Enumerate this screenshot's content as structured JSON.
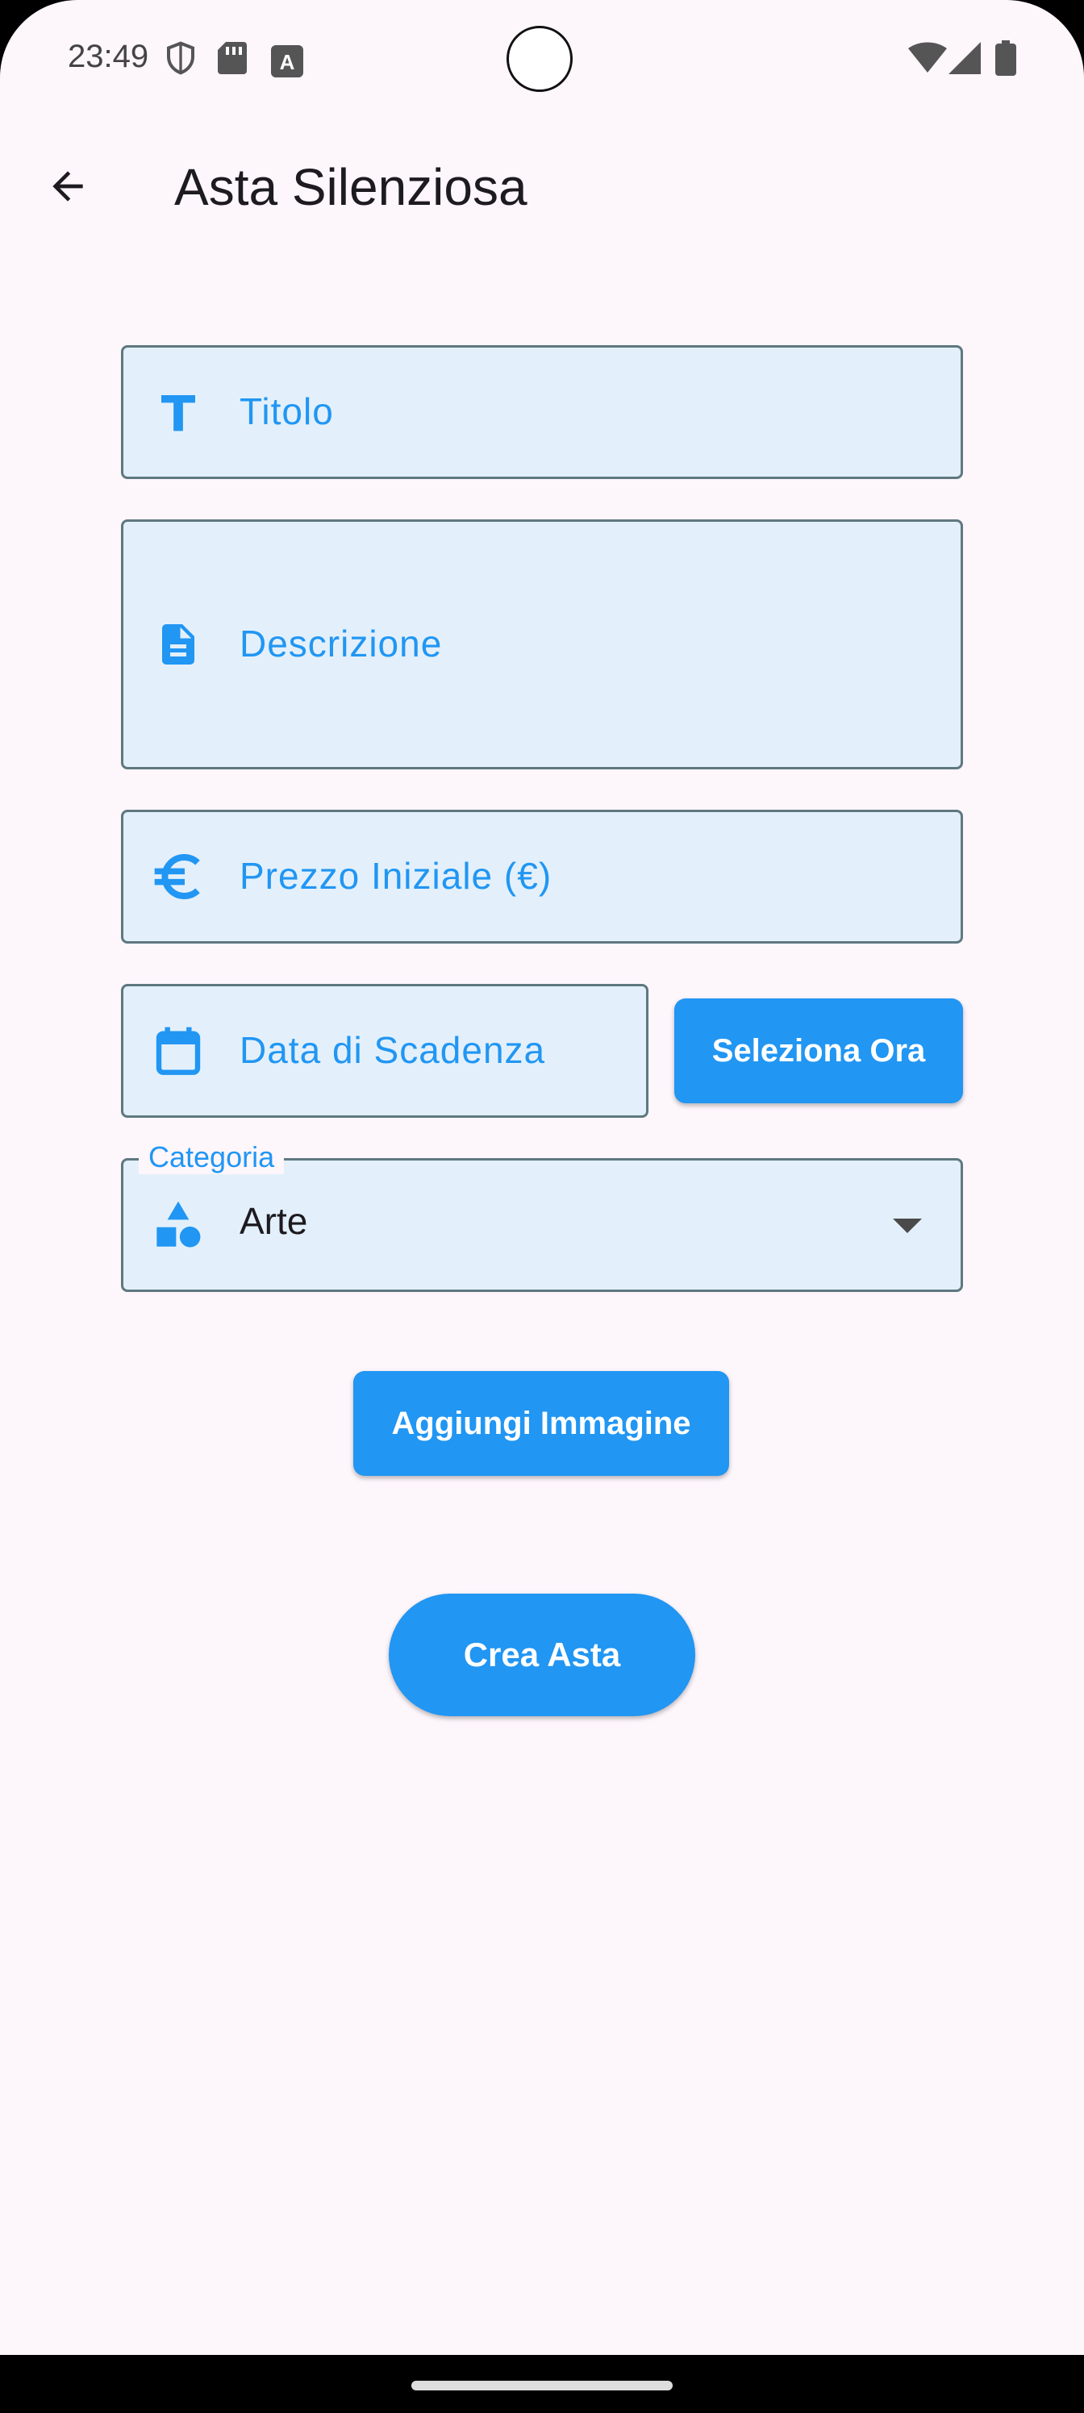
{
  "status_bar": {
    "time": "23:49",
    "left_icons": [
      "shield-icon",
      "sd-card-icon",
      "keyboard-a-icon"
    ],
    "right_icons": [
      "wifi-icon",
      "signal-icon",
      "battery-icon"
    ]
  },
  "app_bar": {
    "back_icon": "arrow-back-icon",
    "title": "Asta Silenziosa"
  },
  "form": {
    "title_field": {
      "label": "Titolo",
      "icon": "title-icon"
    },
    "description_field": {
      "label": "Descrizione",
      "icon": "document-icon"
    },
    "price_field": {
      "label": "Prezzo Iniziale (€)",
      "icon": "euro-icon"
    },
    "date_field": {
      "label": "Data di Scadenza",
      "icon": "calendar-icon"
    },
    "time_button": {
      "label": "Seleziona Ora"
    },
    "category": {
      "legend": "Categoria",
      "value": "Arte",
      "icon": "category-shapes-icon"
    },
    "add_image_button": {
      "label": "Aggiungi Immagine"
    },
    "create_button": {
      "label": "Crea Asta"
    }
  },
  "colors": {
    "accent": "#2196f3",
    "field_fill": "#e3f0fb",
    "field_border": "#5f7880",
    "background": "#fdf6fb"
  }
}
